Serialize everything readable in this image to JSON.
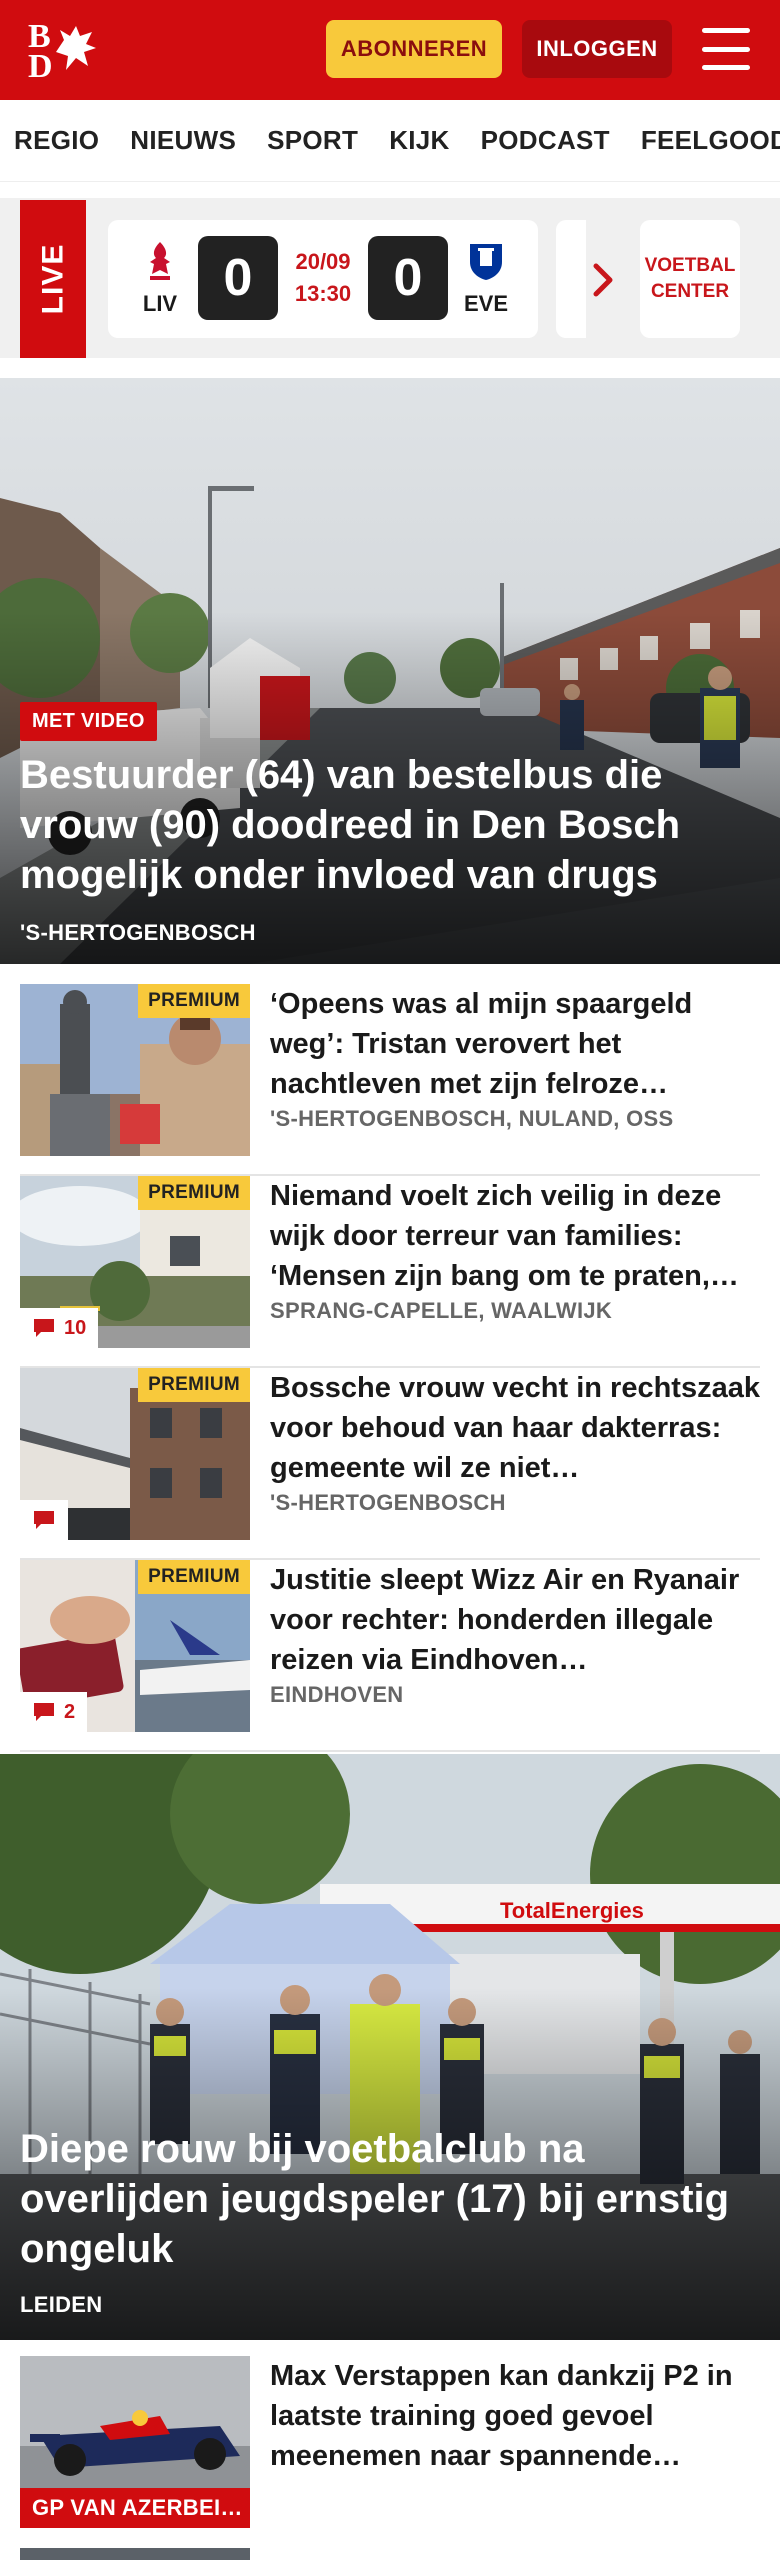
{
  "header": {
    "logo_letters": [
      "B",
      "D"
    ],
    "subscribe_label": "ABONNEREN",
    "login_label": "INLOGGEN",
    "brand_color": "#d00c0f",
    "accent_color": "#f8c93b"
  },
  "nav": {
    "items": [
      "REGIO",
      "NIEUWS",
      "SPORT",
      "KIJK",
      "PODCAST",
      "FEELGOOD"
    ]
  },
  "live": {
    "label": "LIVE",
    "match": {
      "home_code": "LIV",
      "away_code": "EVE",
      "home_score": "0",
      "away_score": "0",
      "date": "20/09",
      "time": "13:30"
    },
    "more_label": "VOETBAL CENTER"
  },
  "hero1": {
    "badge": "MET VIDEO",
    "title": "Bestuurder (64) van bestelbus die vrouw (90) doodreed in Den Bosch mogelijk onder invloed van drugs",
    "location": "'S-HERTOGENBOSCH"
  },
  "articles": [
    {
      "premium": "PREMIUM",
      "title": "‘Opeens was al mijn spaargeld weg’: Tristan verovert het nachtleven met zijn felroze…",
      "location": "'S-HERTOGENBOSCH, NULAND, OSS",
      "comments": ""
    },
    {
      "premium": "PREMIUM",
      "title": "Niemand voelt zich veilig in deze wijk door terreur van families: ‘Mensen zijn bang om te praten,…",
      "location": "SPRANG-CAPELLE, WAALWIJK",
      "comments": "10"
    },
    {
      "premium": "PREMIUM",
      "title": "Bossche vrouw vecht in rechtszaak voor behoud van haar dakterras: gemeente wil ze niet…",
      "location": "'S-HERTOGENBOSCH",
      "comments": ""
    },
    {
      "premium": "PREMIUM",
      "title": "Justitie sleept Wizz Air en Ryanair voor rechter: honderden illegale reizen via Eindhoven…",
      "location": "EINDHOVEN",
      "comments": "2"
    }
  ],
  "hero2": {
    "title": "Diepe rouw bij voetbalclub na overlijden jeugdspeler (17) bij ernstig ongeluk",
    "location": "LEIDEN",
    "sign_text": "TotalEnergies"
  },
  "bottom_article": {
    "badge": "GP VAN AZERBEI…",
    "title": "Max Verstappen kan dankzij P2 in laatste training goed gevoel meenemen naar spannende…"
  }
}
